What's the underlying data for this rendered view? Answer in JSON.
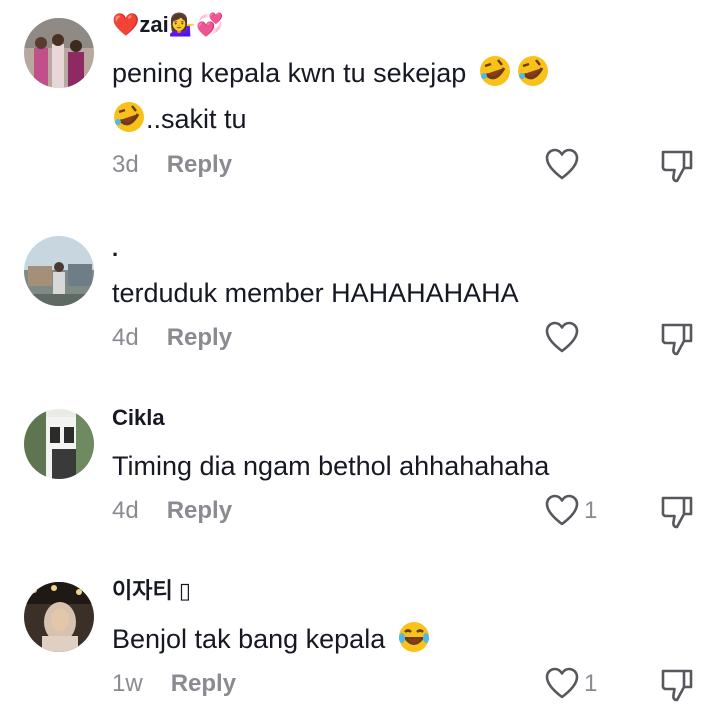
{
  "comments": [
    {
      "username": "❤️zai💁‍♀️💞",
      "text_line1": "pening kepala kwn tu sekejap",
      "text_line2": "..sakit tu",
      "time": "3d",
      "reply": "Reply",
      "likes": ""
    },
    {
      "username": ".",
      "text_line1": "terduduk member HAHAHAHAHA",
      "time": "4d",
      "reply": "Reply",
      "likes": ""
    },
    {
      "username": "Cikla",
      "text_line1": "Timing dia ngam bethol ahhahahaha",
      "time": "4d",
      "reply": "Reply",
      "likes": "1"
    },
    {
      "username": "이자티 ▯",
      "text_line1": "Benjol tak bang kepala",
      "time": "1w",
      "reply": "Reply",
      "likes": "1"
    }
  ],
  "icons": {
    "like": "heart-outline-icon",
    "dislike": "thumbs-down-icon",
    "emoji1": "rolling-on-floor-laughing-emoji",
    "emoji2": "face-with-tears-of-joy-emoji"
  },
  "colors": {
    "text": "#161823",
    "muted": "#8a8b91",
    "emoji_yellow": "#f9c21b"
  }
}
